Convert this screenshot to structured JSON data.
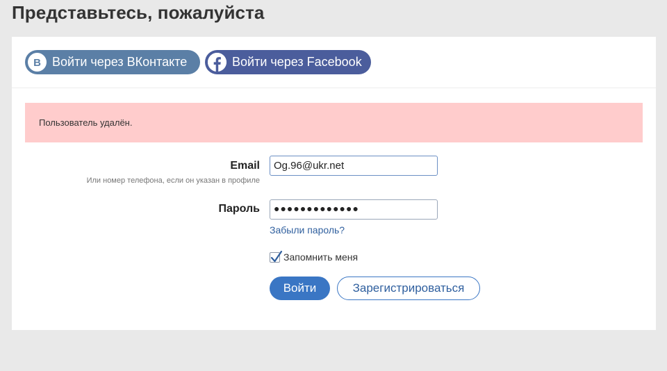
{
  "page": {
    "title": "Представьтесь, пожалуйста"
  },
  "social": {
    "vk_label": "Войти через ВКонтакте",
    "vk_color": "#5b7fa6",
    "vk_icon": "vk-logo-icon",
    "fb_label": "Войти через Facebook",
    "fb_color": "#4b5d9c",
    "fb_icon": "facebook-logo-icon"
  },
  "alert": {
    "message": "Пользователь удалён.",
    "color": "#ffcccc"
  },
  "form": {
    "email_label": "Email",
    "email_hint": "Или номер телефона, если он указан в профиле",
    "email_value": "Og.96@ukr.net",
    "password_label": "Пароль",
    "password_masked": "●●●●●●●●●●●●●",
    "forgot_label": "Забыли пароль?",
    "remember_label": "Запомнить меня",
    "remember_checked": true,
    "login_label": "Войти",
    "register_label": "Зарегистрироваться",
    "accent_color": "#3a76c4"
  }
}
